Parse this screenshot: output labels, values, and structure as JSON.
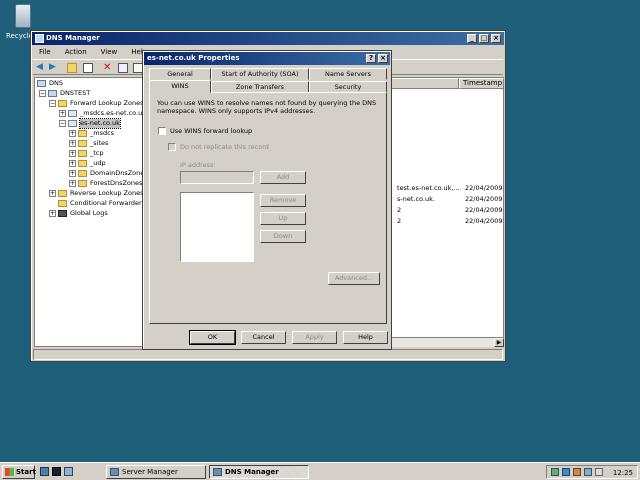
{
  "desktop": {
    "recycle_label": "Recycle Bin"
  },
  "dns_manager": {
    "title": "DNS Manager",
    "menu": [
      "File",
      "Action",
      "View",
      "Help"
    ],
    "tree": [
      {
        "label": "DNS",
        "depth": 0,
        "expander": ""
      },
      {
        "label": "DNSTEST",
        "depth": 1,
        "expander": "−"
      },
      {
        "label": "Forward Lookup Zones",
        "depth": 2,
        "expander": "−"
      },
      {
        "label": "_msdcs.es-net.co.uk",
        "depth": 3,
        "expander": "+"
      },
      {
        "label": "es-net.co.uk",
        "depth": 3,
        "expander": "−",
        "selected": true
      },
      {
        "label": "_msdcs",
        "depth": 4,
        "expander": "+"
      },
      {
        "label": "_sites",
        "depth": 4,
        "expander": "+"
      },
      {
        "label": "_tcp",
        "depth": 4,
        "expander": "+"
      },
      {
        "label": "_udp",
        "depth": 4,
        "expander": "+"
      },
      {
        "label": "DomainDnsZones",
        "depth": 4,
        "expander": "+"
      },
      {
        "label": "ForestDnsZones",
        "depth": 4,
        "expander": "+"
      },
      {
        "label": "Reverse Lookup Zones",
        "depth": 2,
        "expander": "+"
      },
      {
        "label": "Conditional Forwarders",
        "depth": 2,
        "expander": ""
      },
      {
        "label": "Global Logs",
        "depth": 2,
        "expander": "+"
      }
    ],
    "list_header": {
      "timestamp": "Timestamp"
    },
    "list_rows": [
      {
        "data": "test.es-net.co.uk,...",
        "timestamp": "22/04/2009"
      },
      {
        "data": "s-net.co.uk.",
        "timestamp": "22/04/2009"
      },
      {
        "data": "2",
        "timestamp": "22/04/2009"
      },
      {
        "data": "2",
        "timestamp": "22/04/2009"
      }
    ]
  },
  "dialog": {
    "title": "es-net.co.uk Properties",
    "tabs_row1": [
      "General",
      "Start of Authority (SOA)",
      "Name Servers"
    ],
    "tabs_row2": [
      "WINS",
      "Zone Transfers",
      "Security"
    ],
    "description": "You can use WINS to resolve names not found by querying the DNS namespace.  WINS only supports IPv4 addresses.",
    "use_wins_label": "Use WINS forward lookup",
    "do_not_replicate_label": "Do not replicate this record",
    "ip_label": "IP address:",
    "add_label": "Add",
    "remove_label": "Remove",
    "up_label": "Up",
    "down_label": "Down",
    "advanced_label": "Advanced...",
    "ok_label": "OK",
    "cancel_label": "Cancel",
    "apply_label": "Apply",
    "help_label": "Help"
  },
  "taskbar": {
    "start_label": "Start",
    "tasks": [
      "Server Manager",
      "DNS Manager"
    ],
    "clock": "12:25"
  }
}
